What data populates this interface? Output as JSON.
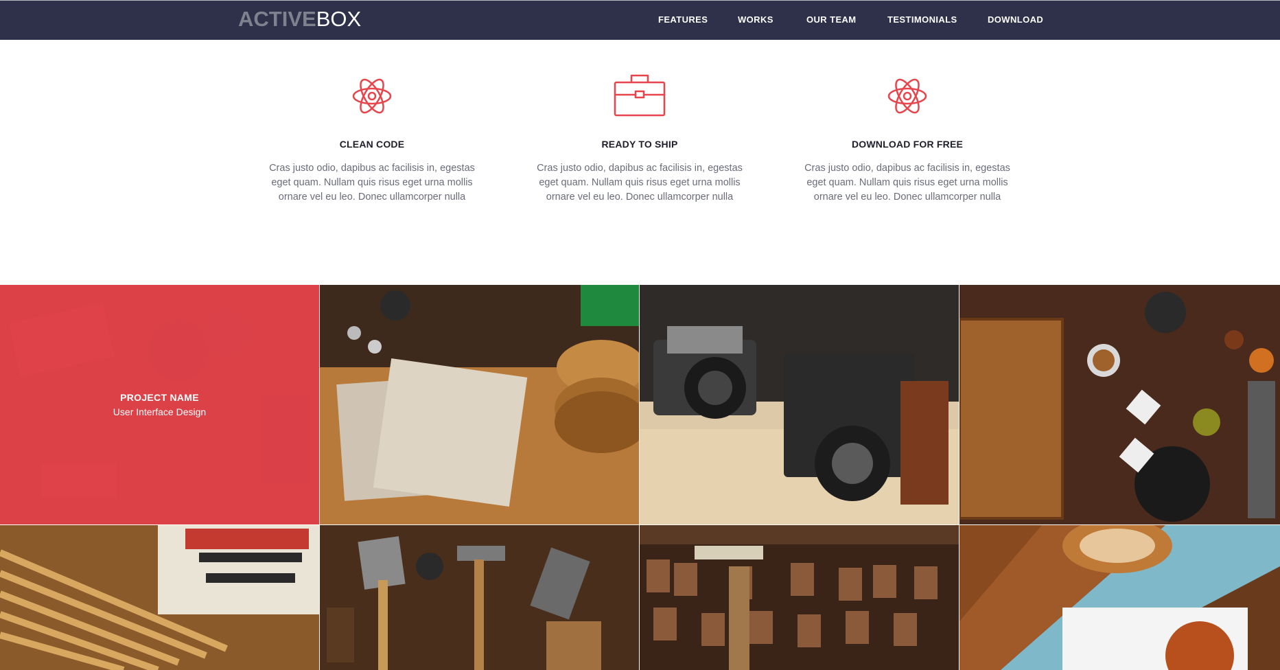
{
  "brand": {
    "logo_bold": "ACTIVE",
    "logo_thin": "BOX"
  },
  "nav": {
    "items": [
      {
        "label": "FEATURES"
      },
      {
        "label": "WORKS"
      },
      {
        "label": "OUR TEAM"
      },
      {
        "label": "TESTIMONIALS"
      },
      {
        "label": "DOWNLOAD"
      }
    ]
  },
  "features": [
    {
      "icon": "atom-icon",
      "title": "CLEAN CODE",
      "text": "Cras justo odio, dapibus ac facilisis in, egestas eget quam. Nullam quis risus eget urna mollis ornare vel eu leo. Donec ullamcorper nulla"
    },
    {
      "icon": "briefcase-icon",
      "title": "READY TO SHIP",
      "text": "Cras justo odio, dapibus ac facilisis in, egestas eget quam. Nullam quis risus eget urna mollis ornare vel eu leo. Donec ullamcorper nulla"
    },
    {
      "icon": "atom-icon",
      "title": "DOWNLOAD FOR FREE",
      "text": "Cras justo odio, dapibus ac facilisis in, egestas eget quam. Nullam quis risus eget urna mollis ornare vel eu leo. Donec ullamcorper nulla"
    }
  ],
  "portfolio": {
    "hover_project": {
      "name": "PROJECT NAME",
      "category": "User Interface Design"
    },
    "tiles": [
      {
        "subject": "letterpress print blocks"
      },
      {
        "subject": "notebooks and wooden coasters"
      },
      {
        "subject": "vintage cameras"
      },
      {
        "subject": "cutting board and spices"
      },
      {
        "subject": "rulers and vintage sign"
      },
      {
        "subject": "vintage tools"
      },
      {
        "subject": "wood type letters"
      },
      {
        "subject": "coffee and food plate"
      }
    ]
  },
  "colors": {
    "navbar": "#2f3049",
    "accent": "#e8444b",
    "heading": "#1e1e2a",
    "body_text": "#6a6c7a"
  }
}
